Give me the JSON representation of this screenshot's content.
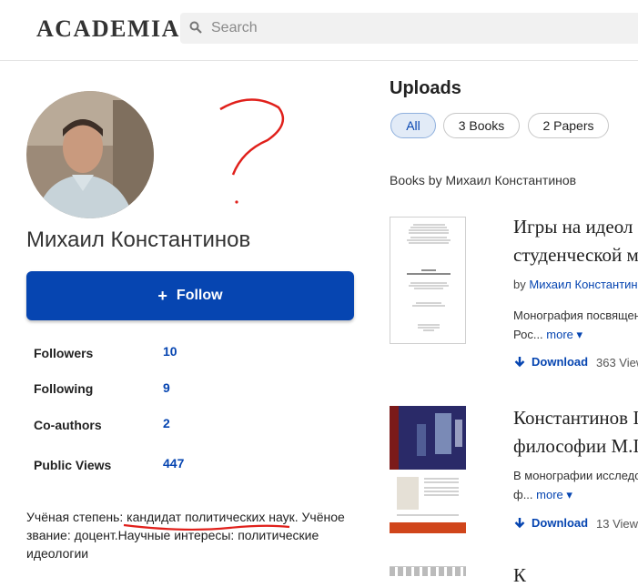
{
  "header": {
    "logo": "ACADEMIA",
    "search_placeholder": "Search"
  },
  "profile": {
    "name": "Михаил Константинов",
    "follow_label": "Follow",
    "stats": [
      {
        "label": "Followers",
        "value": "10"
      },
      {
        "label": "Following",
        "value": "9"
      },
      {
        "label": "Co-authors",
        "value": "2"
      },
      {
        "label": "Public Views",
        "value": "447"
      }
    ],
    "bio": "Учёная степень: кандидат политических наук. Учёное звание: доцент.Научные интересы: политические идеологии"
  },
  "uploads": {
    "title": "Uploads",
    "chips": [
      {
        "label": "All",
        "active": true
      },
      {
        "label": "3 Books",
        "active": false
      },
      {
        "label": "2 Papers",
        "active": false
      }
    ],
    "section_title": "Books by Михаил Константинов",
    "books": [
      {
        "title_line1": "Игры на идеол",
        "title_line2": "студенческой м",
        "by": "by",
        "author": "Михаил Константин",
        "desc_line1": "Монография посвящен",
        "desc_line2": "Рос...",
        "more": "more",
        "download": "Download",
        "views": "363 View"
      },
      {
        "title_line1": "Константинов I",
        "title_line2": "философии М.I",
        "desc_line1": "В монографии исследо",
        "desc_line2": "ф...",
        "more": "more",
        "download": "Download",
        "views": "13 View"
      }
    ],
    "third_title": "К"
  },
  "colors": {
    "accent": "#0645b1",
    "annotation": "#e0201b"
  }
}
